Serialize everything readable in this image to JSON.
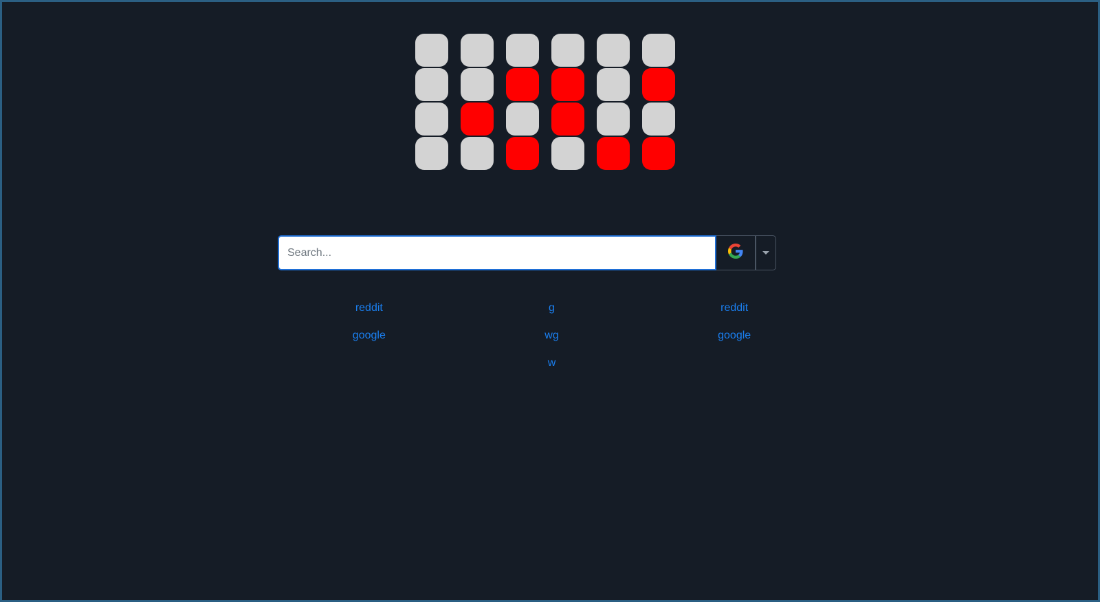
{
  "binary_clock": {
    "rows": [
      [
        0,
        0,
        0,
        0,
        0,
        0
      ],
      [
        0,
        0,
        1,
        1,
        0,
        1
      ],
      [
        0,
        1,
        0,
        1,
        0,
        0
      ],
      [
        0,
        0,
        1,
        0,
        1,
        1
      ]
    ],
    "on_color": "#ff0000",
    "off_color": "#d3d3d3"
  },
  "search": {
    "placeholder": "Search...",
    "value": "",
    "engine_icon": "google-g-icon",
    "dropdown_icon": "caret-down-icon"
  },
  "links": [
    {
      "label": "reddit"
    },
    {
      "label": "g"
    },
    {
      "label": "reddit"
    },
    {
      "label": "google"
    },
    {
      "label": "wg"
    },
    {
      "label": "google"
    },
    {
      "label": ""
    },
    {
      "label": "w"
    },
    {
      "label": ""
    }
  ],
  "colors": {
    "background": "#151c26",
    "link": "#1a7ff0",
    "input_border": "#1f6fd6"
  }
}
